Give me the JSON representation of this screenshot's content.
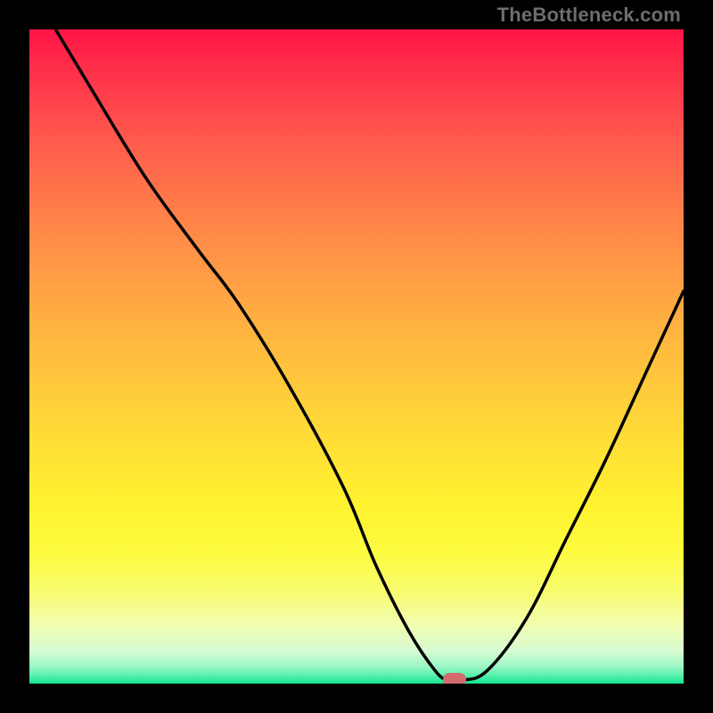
{
  "watermark": "TheBottleneck.com",
  "colors": {
    "frame": "#000000",
    "curve": "#000000",
    "marker": "#d26b6b"
  },
  "chart_data": {
    "type": "line",
    "title": "",
    "xlabel": "",
    "ylabel": "",
    "xlim": [
      0,
      100
    ],
    "ylim": [
      0,
      100
    ],
    "grid": false,
    "legend": false,
    "series": [
      {
        "name": "bottleneck-curve",
        "x": [
          4,
          10,
          18,
          26,
          32,
          40,
          48,
          53,
          58,
          62,
          64,
          66,
          70,
          76,
          82,
          88,
          94,
          100
        ],
        "values": [
          100,
          90,
          77,
          66,
          58,
          45,
          30,
          18,
          8,
          2,
          0.5,
          0.5,
          2,
          10,
          22,
          34,
          47,
          60
        ]
      }
    ],
    "marker": {
      "x": 65,
      "y": 0.5
    },
    "gradient_stops": [
      {
        "pct": 0,
        "color": "#ff1446"
      },
      {
        "pct": 6,
        "color": "#ff2f4a"
      },
      {
        "pct": 17,
        "color": "#ff5a4d"
      },
      {
        "pct": 30,
        "color": "#ff8648"
      },
      {
        "pct": 42,
        "color": "#ffa943"
      },
      {
        "pct": 54,
        "color": "#ffc83c"
      },
      {
        "pct": 64,
        "color": "#ffe035"
      },
      {
        "pct": 73,
        "color": "#fff22f"
      },
      {
        "pct": 80,
        "color": "#fdfb40"
      },
      {
        "pct": 86,
        "color": "#f8fc70"
      },
      {
        "pct": 91,
        "color": "#f1fdb0"
      },
      {
        "pct": 95,
        "color": "#d8fbd2"
      },
      {
        "pct": 97.5,
        "color": "#97f6c4"
      },
      {
        "pct": 99,
        "color": "#4beea8"
      },
      {
        "pct": 100,
        "color": "#13e58e"
      }
    ]
  }
}
